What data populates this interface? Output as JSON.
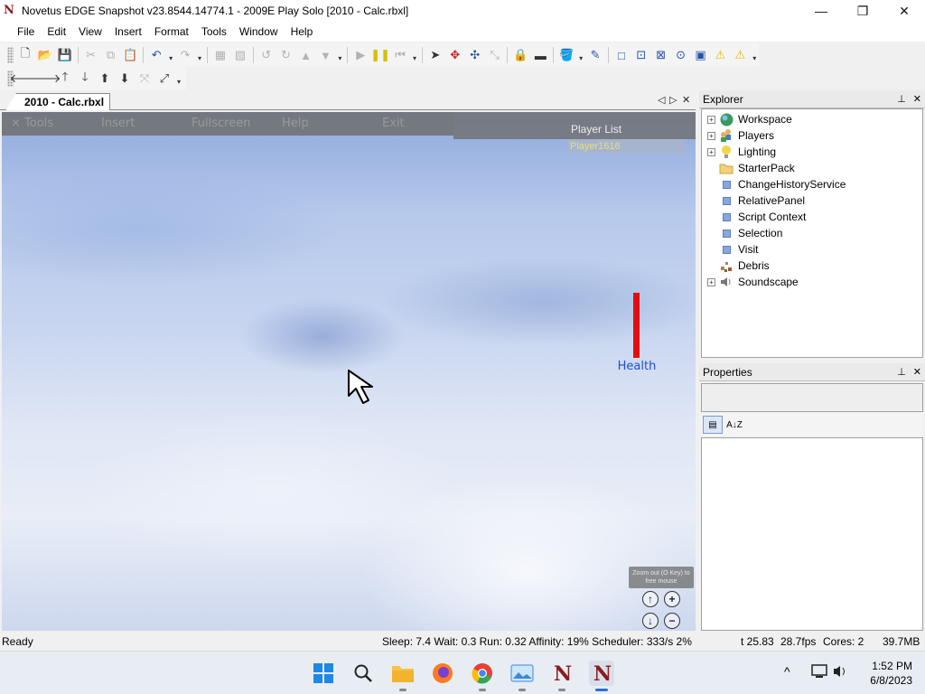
{
  "window": {
    "title": "Novetus EDGE Snapshot v23.8544.14774.1 - 2009E Play Solo [2010 - Calc.rbxl]",
    "logo_letter": "N",
    "controls": {
      "minimize": "—",
      "maximize": "❐",
      "close": "✕"
    }
  },
  "menu": [
    "File",
    "Edit",
    "View",
    "Insert",
    "Format",
    "Tools",
    "Window",
    "Help"
  ],
  "document_tab": {
    "label": "2010 - Calc.rbxl",
    "prev": "◁",
    "next": "▷",
    "close": "✕"
  },
  "game": {
    "menu": [
      "× Tools",
      "Insert",
      "Fullscreen",
      "Help",
      "Exit"
    ],
    "player_list": "Player List",
    "player_name": "Player1616",
    "health_label": "Health",
    "health_fraction": 1.0,
    "zoom_hint": "Zoom out (O Key) to free mouse",
    "cam_up": "↑",
    "cam_zoom_in": "+",
    "cam_down": "↓",
    "cam_zoom_out": "−"
  },
  "explorer": {
    "title": "Explorer",
    "pin": "📌",
    "close": "✕",
    "items": [
      {
        "label": "Workspace",
        "expandable": true,
        "icon": "globe-icon"
      },
      {
        "label": "Players",
        "expandable": true,
        "icon": "players-icon"
      },
      {
        "label": "Lighting",
        "expandable": true,
        "icon": "lightbulb-icon"
      },
      {
        "label": "StarterPack",
        "expandable": false,
        "icon": "folder-icon"
      },
      {
        "label": "ChangeHistoryService",
        "expandable": false,
        "icon": "service-icon"
      },
      {
        "label": "RelativePanel",
        "expandable": false,
        "icon": "service-icon"
      },
      {
        "label": "Script Context",
        "expandable": false,
        "icon": "service-icon"
      },
      {
        "label": "Selection",
        "expandable": false,
        "icon": "service-icon"
      },
      {
        "label": "Visit",
        "expandable": false,
        "icon": "service-icon"
      },
      {
        "label": "Debris",
        "expandable": false,
        "icon": "debris-icon"
      },
      {
        "label": "Soundscape",
        "expandable": true,
        "icon": "speaker-icon"
      }
    ]
  },
  "properties": {
    "title": "Properties",
    "pin": "📌",
    "close": "✕",
    "sort_category": "▤",
    "sort_alpha": "A↓Z"
  },
  "status": {
    "ready": "Ready",
    "perf": "Sleep: 7.4 Wait: 0.3 Run: 0.32 Affinity: 19% Scheduler: 333/s 2%",
    "time": "t 25.83",
    "fps": "28.7fps",
    "cores": "Cores: 2",
    "memory": "39.7MB"
  },
  "taskbar": {
    "apps": [
      "start-icon",
      "search-icon",
      "file-explorer-icon",
      "firefox-icon",
      "chrome-icon",
      "photos-icon",
      "novetus-icon",
      "novetus-active-icon"
    ],
    "tray": {
      "chevron": "^",
      "time": "1:52 PM",
      "date": "6/8/2023"
    }
  },
  "colors": {
    "health": "#e10e0e",
    "health_label": "#1a4fd8",
    "player_name": "#e8e070",
    "accent": "#2a6fd6"
  }
}
